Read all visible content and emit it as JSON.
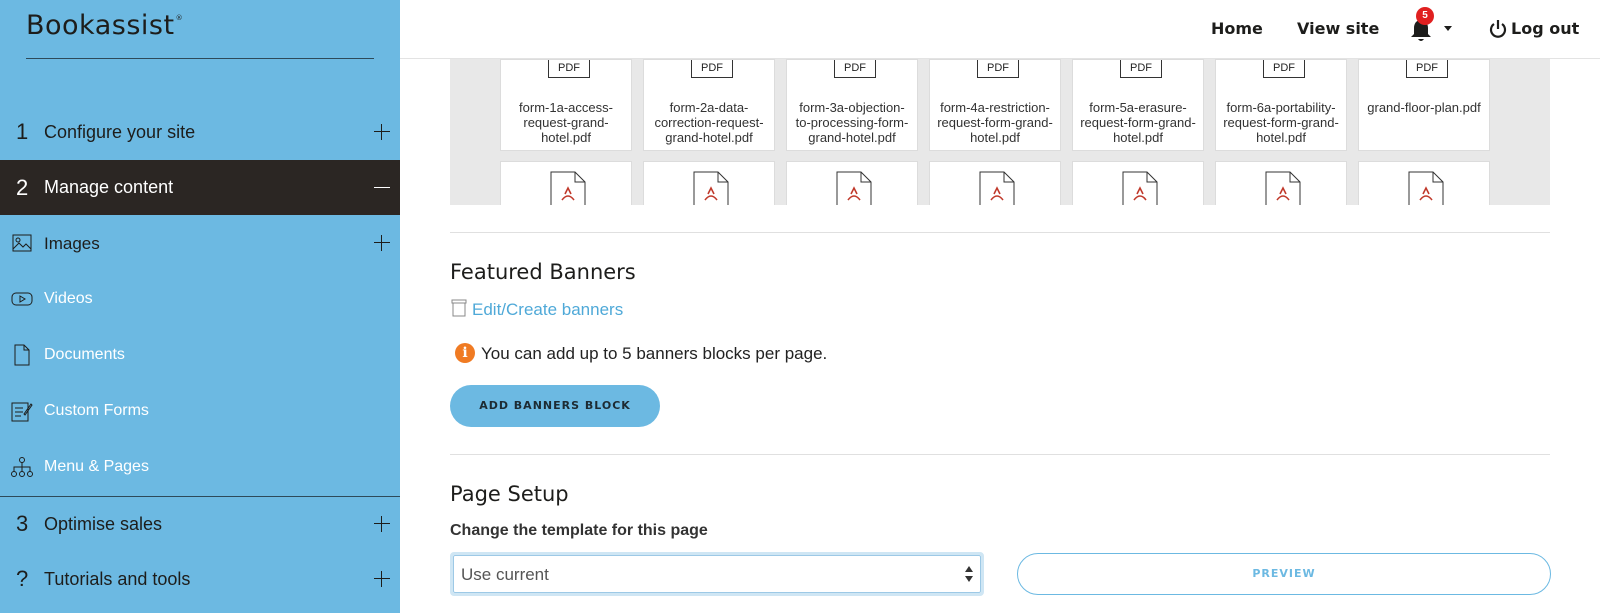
{
  "brand": {
    "name": "Bookassist",
    "mark": "®"
  },
  "sidebar": {
    "sections": [
      {
        "num": "1",
        "label": "Configure your site"
      },
      {
        "num": "2",
        "label": "Manage content"
      },
      {
        "num": "3",
        "label": "Optimise sales"
      },
      {
        "num": "?",
        "label": "Tutorials and tools"
      }
    ],
    "items": [
      {
        "label": "Images",
        "icon": "image-icon"
      },
      {
        "label": "Videos",
        "icon": "video-icon"
      },
      {
        "label": "Documents",
        "icon": "document-icon"
      },
      {
        "label": "Custom Forms",
        "icon": "form-icon"
      },
      {
        "label": "Menu & Pages",
        "icon": "sitemap-icon"
      }
    ]
  },
  "topbar": {
    "home": "Home",
    "view_site": "View site",
    "notifications_count": "5",
    "logout": "Log out"
  },
  "files": {
    "tag": "PDF",
    "row1": [
      "form-1a-access-request-grand-hotel.pdf",
      "form-2a-data-correction-request-grand-hotel.pdf",
      "form-3a-objection-to-processing-form-grand-hotel.pdf",
      "form-4a-restriction-request-form-grand-hotel.pdf",
      "form-5a-erasure-request-form-grand-hotel.pdf",
      "form-6a-portability-request-form-grand-hotel.pdf",
      "grand-floor-plan.pdf"
    ]
  },
  "banners": {
    "heading": "Featured Banners",
    "edit_link": "Edit/Create banners",
    "info": "You can add up to 5 banners blocks per page.",
    "add_button": "ADD BANNERS BLOCK"
  },
  "page_setup": {
    "heading": "Page Setup",
    "template_label": "Change the template for this page",
    "template_value": "Use current",
    "preview_button": "PREVIEW"
  },
  "colors": {
    "sidebar": "#6cb9e2",
    "active": "#2b2623",
    "accent": "#4fa9d8",
    "info": "#f07b23",
    "badge": "#e02020"
  }
}
